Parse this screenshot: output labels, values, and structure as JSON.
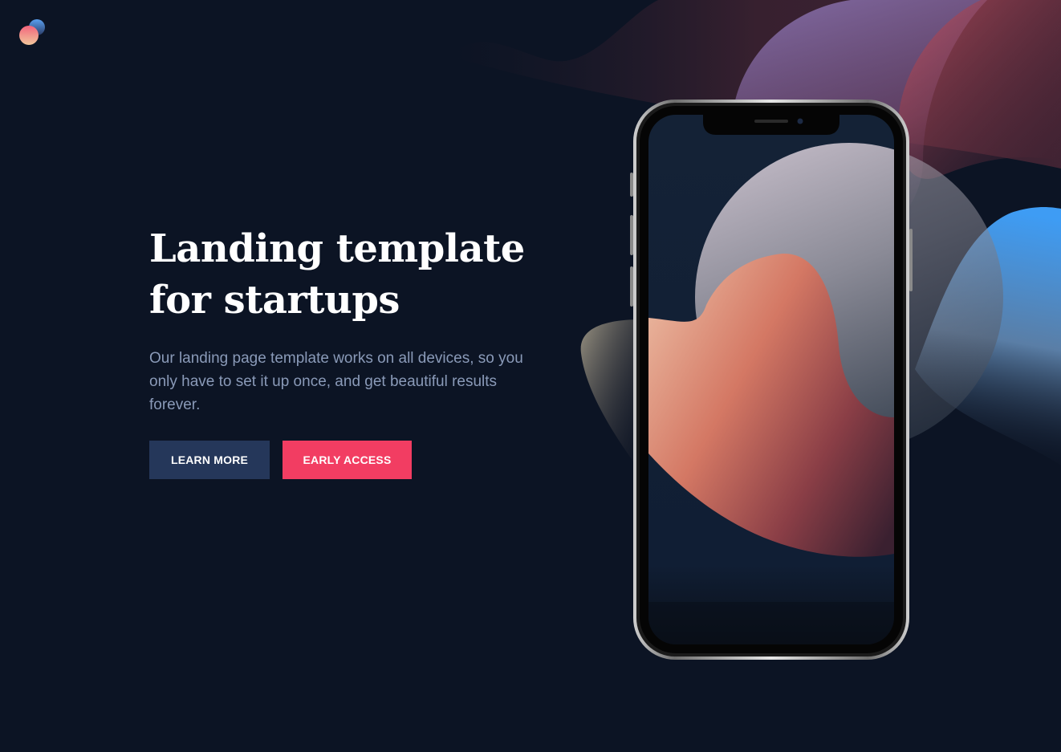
{
  "hero": {
    "title": "Landing template for startups",
    "paragraph": "Our landing page template works on all devices, so you only have to set it up once, and get beautiful results forever."
  },
  "buttons": {
    "learn_more": "LEARN MORE",
    "early_access": "EARLY ACCESS"
  },
  "colors": {
    "background": "#0c1424",
    "button_dark": "#25375a",
    "button_primary": "#f23d62",
    "paragraph_text": "#8a9ab8",
    "title_text": "#ffffff"
  },
  "icons": {
    "logo": "brand-logo-icon"
  }
}
